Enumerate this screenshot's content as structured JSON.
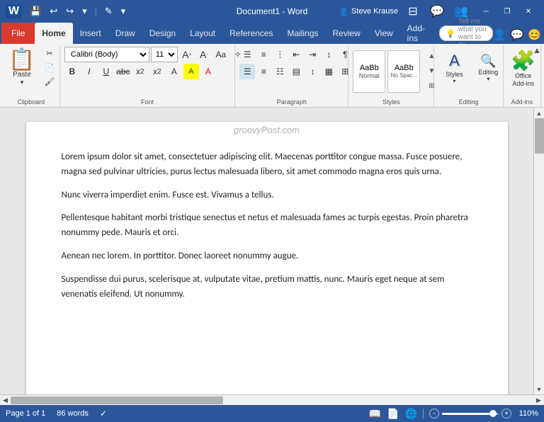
{
  "titlebar": {
    "app_name": "Document1 - Word",
    "user_name": "Steve Krause",
    "quick_access": [
      "save",
      "undo",
      "redo",
      "customize"
    ],
    "window_controls": [
      "minimize",
      "restore",
      "close"
    ]
  },
  "ribbon": {
    "tabs": [
      {
        "id": "file",
        "label": "File",
        "active": false
      },
      {
        "id": "home",
        "label": "Home",
        "active": true
      },
      {
        "id": "insert",
        "label": "Insert",
        "active": false
      },
      {
        "id": "draw",
        "label": "Draw",
        "active": false
      },
      {
        "id": "design",
        "label": "Design",
        "active": false
      },
      {
        "id": "layout",
        "label": "Layout",
        "active": false
      },
      {
        "id": "references",
        "label": "References",
        "active": false
      },
      {
        "id": "mailings",
        "label": "Mailings",
        "active": false
      },
      {
        "id": "review",
        "label": "Review",
        "active": false
      },
      {
        "id": "view",
        "label": "View",
        "active": false
      },
      {
        "id": "addins",
        "label": "Add-ins",
        "active": false
      }
    ],
    "groups": {
      "clipboard": {
        "label": "Clipboard",
        "paste_label": "Paste"
      },
      "font": {
        "label": "Font",
        "font_name": "Calibri (Body)",
        "font_size": "11",
        "bold": "B",
        "italic": "I",
        "underline": "U"
      },
      "paragraph": {
        "label": "Paragraph"
      },
      "styles": {
        "label": "Styles",
        "items": [
          "Normal",
          "No Spac..."
        ]
      },
      "editing": {
        "label": "Editing",
        "button_label": "Editing"
      },
      "addins_group": {
        "label": "Add-ins",
        "office_label": "Office\nAdd-ins"
      }
    },
    "tell_me": {
      "placeholder": "Tell me what you want to do"
    }
  },
  "document": {
    "watermark": "groovyPost.com",
    "paragraphs": [
      "Lorem ipsum dolor sit amet, consectetuer adipiscing elit. Maecenas porttitor congue massa. Fusce posuere, magna sed pulvinar ultricies, purus lectus malesuada libero, sit amet commodo magna eros quis urna.",
      "Nunc viverra imperdiet enim. Fusce est. Vivamus a tellus.",
      "Pellentesque habitant morbi tristique senectus et netus et malesuada fames ac turpis egestas. Proin pharetra nonummy pede. Mauris et orci.",
      "Aenean nec lorem. In porttitor. Donec laoreet nonummy augue.",
      "Suspendisse dui purus, scelerisque at, vulputate vitae, pretium mattis, nunc. Mauris eget neque at sem venenatis eleifend. Ut nonummy."
    ]
  },
  "statusbar": {
    "page_info": "Page 1 of 1",
    "word_count": "86 words",
    "zoom_percent": "110%",
    "zoom_value": 90
  }
}
